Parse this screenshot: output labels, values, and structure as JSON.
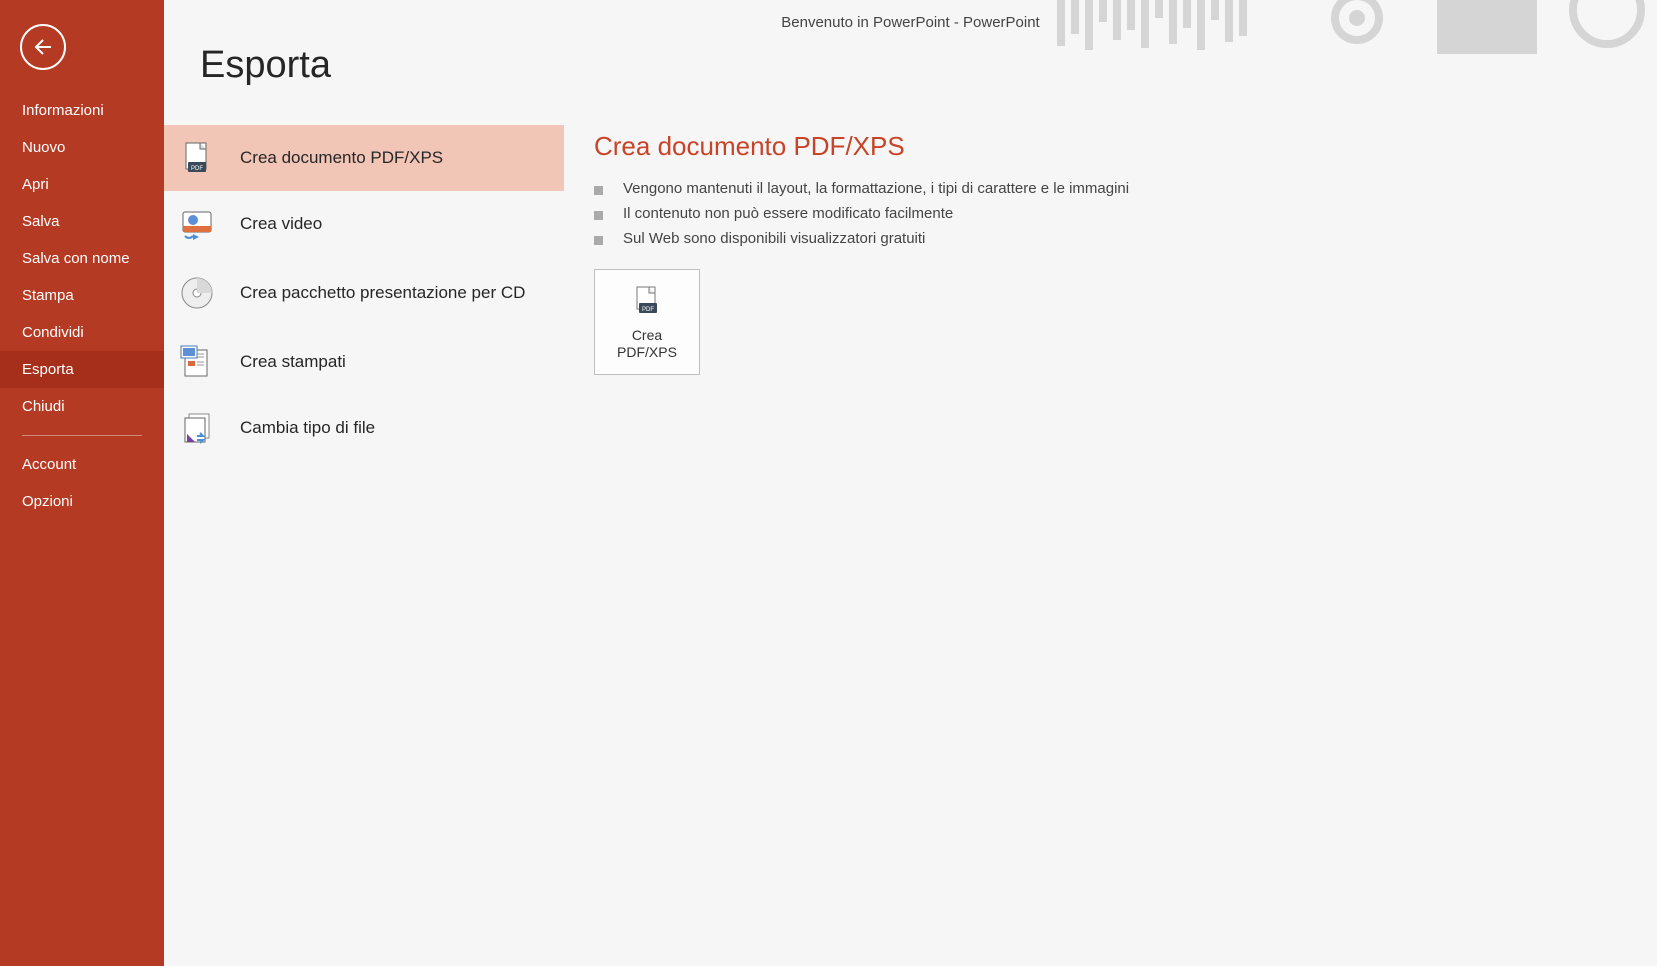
{
  "titleBar": "Benvenuto in PowerPoint - PowerPoint",
  "sidebar": {
    "items": [
      {
        "label": "Informazioni"
      },
      {
        "label": "Nuovo"
      },
      {
        "label": "Apri"
      },
      {
        "label": "Salva"
      },
      {
        "label": "Salva con nome"
      },
      {
        "label": "Stampa"
      },
      {
        "label": "Condividi"
      },
      {
        "label": "Esporta"
      },
      {
        "label": "Chiudi"
      }
    ],
    "bottomItems": [
      {
        "label": "Account"
      },
      {
        "label": "Opzioni"
      }
    ]
  },
  "pageTitle": "Esporta",
  "exportOptions": [
    {
      "label": "Crea documento PDF/XPS"
    },
    {
      "label": "Crea video"
    },
    {
      "label": "Crea pacchetto presentazione per CD"
    },
    {
      "label": "Crea stampati"
    },
    {
      "label": "Cambia tipo di file"
    }
  ],
  "details": {
    "title": "Crea documento PDF/XPS",
    "bullets": [
      "Vengono mantenuti il layout, la formattazione, i tipi di carattere e le immagini",
      "Il contenuto non può essere modificato facilmente",
      "Sul Web sono disponibili visualizzatori gratuiti"
    ],
    "actionLabel": "Crea PDF/XPS"
  },
  "colors": {
    "sidebarBg": "#b43a23",
    "accent": "#c74428",
    "selectedBg": "#f2c6b6"
  }
}
